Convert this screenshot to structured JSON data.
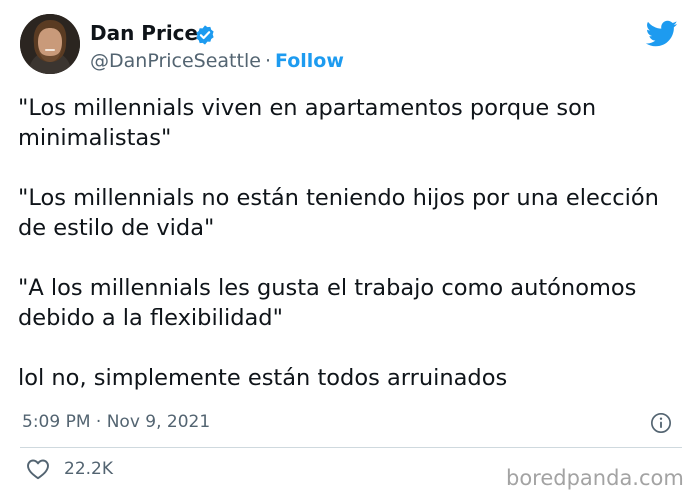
{
  "tweet": {
    "display_name": "Dan Price",
    "handle": "@DanPriceSeattle",
    "separator": "·",
    "follow_label": "Follow",
    "paragraphs": [
      "\"Los millennials viven en apartamentos porque son minimalistas\"",
      "\"Los millennials no están teniendo hijos por una elección de estilo de vida\"",
      "\"A los millennials les gusta el trabajo como autónomos debido a la flexibilidad\"",
      "lol no, simplemente están todos arruinados"
    ],
    "timestamp": "5:09 PM · Nov 9, 2021",
    "like_count": "22.2K"
  },
  "watermark": "boredpanda.com",
  "icons": {
    "avatar": "avatar",
    "verified": "verified-badge-icon",
    "brand": "twitter-bird-icon",
    "info": "info-icon",
    "like": "heart-icon"
  },
  "colors": {
    "accent": "#1d9bf0",
    "text": "#0f1419",
    "secondary": "#536471",
    "divider": "#cfd9de",
    "watermark": "#a3a3a3"
  }
}
